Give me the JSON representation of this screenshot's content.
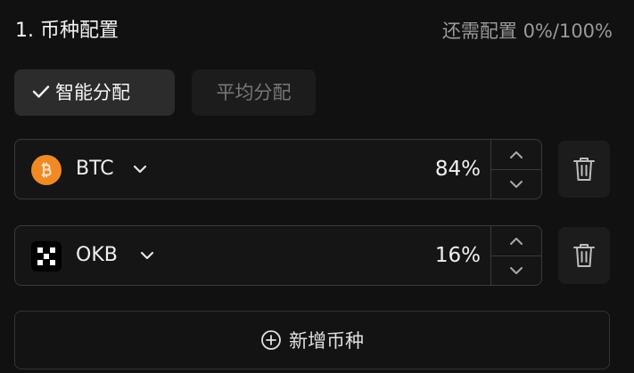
{
  "header": {
    "title": "1. 币种配置",
    "progress_text": "还需配置 0%/100%"
  },
  "allocation_mode": {
    "options": [
      {
        "label": "智能分配",
        "selected": true
      },
      {
        "label": "平均分配",
        "selected": false
      }
    ]
  },
  "coins": [
    {
      "symbol": "BTC",
      "percent": "84%",
      "icon": "bitcoin-icon",
      "icon_color": "#f08a24"
    },
    {
      "symbol": "OKB",
      "percent": "16%",
      "icon": "okb-icon",
      "icon_color": "#ffffff"
    }
  ],
  "add_button": {
    "label": "新增币种"
  },
  "colors": {
    "background": "#111111",
    "border": "#3a3a3a",
    "text_primary": "#f0f0f0",
    "text_muted": "#9a9a9a"
  }
}
